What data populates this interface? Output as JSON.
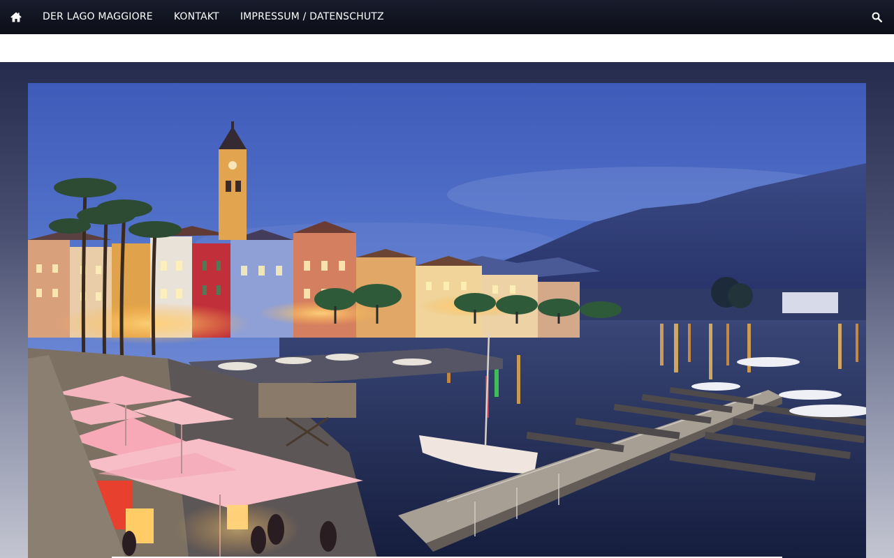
{
  "nav": {
    "home_icon": "home-icon",
    "items": [
      {
        "label": "DER LAGO MAGGIORE"
      },
      {
        "label": "KONTAKT"
      },
      {
        "label": "IMPRESSUM / DATENSCHUTZ"
      }
    ],
    "search_icon": "search-icon"
  },
  "hero": {
    "image_subject": "lakeside-town-at-dusk"
  },
  "colors": {
    "nav_bg": "#0c0e17",
    "nav_text": "#ffffff",
    "hero_bg_top": "#252b4d",
    "hero_bg_bottom": "#c3c5d1"
  }
}
